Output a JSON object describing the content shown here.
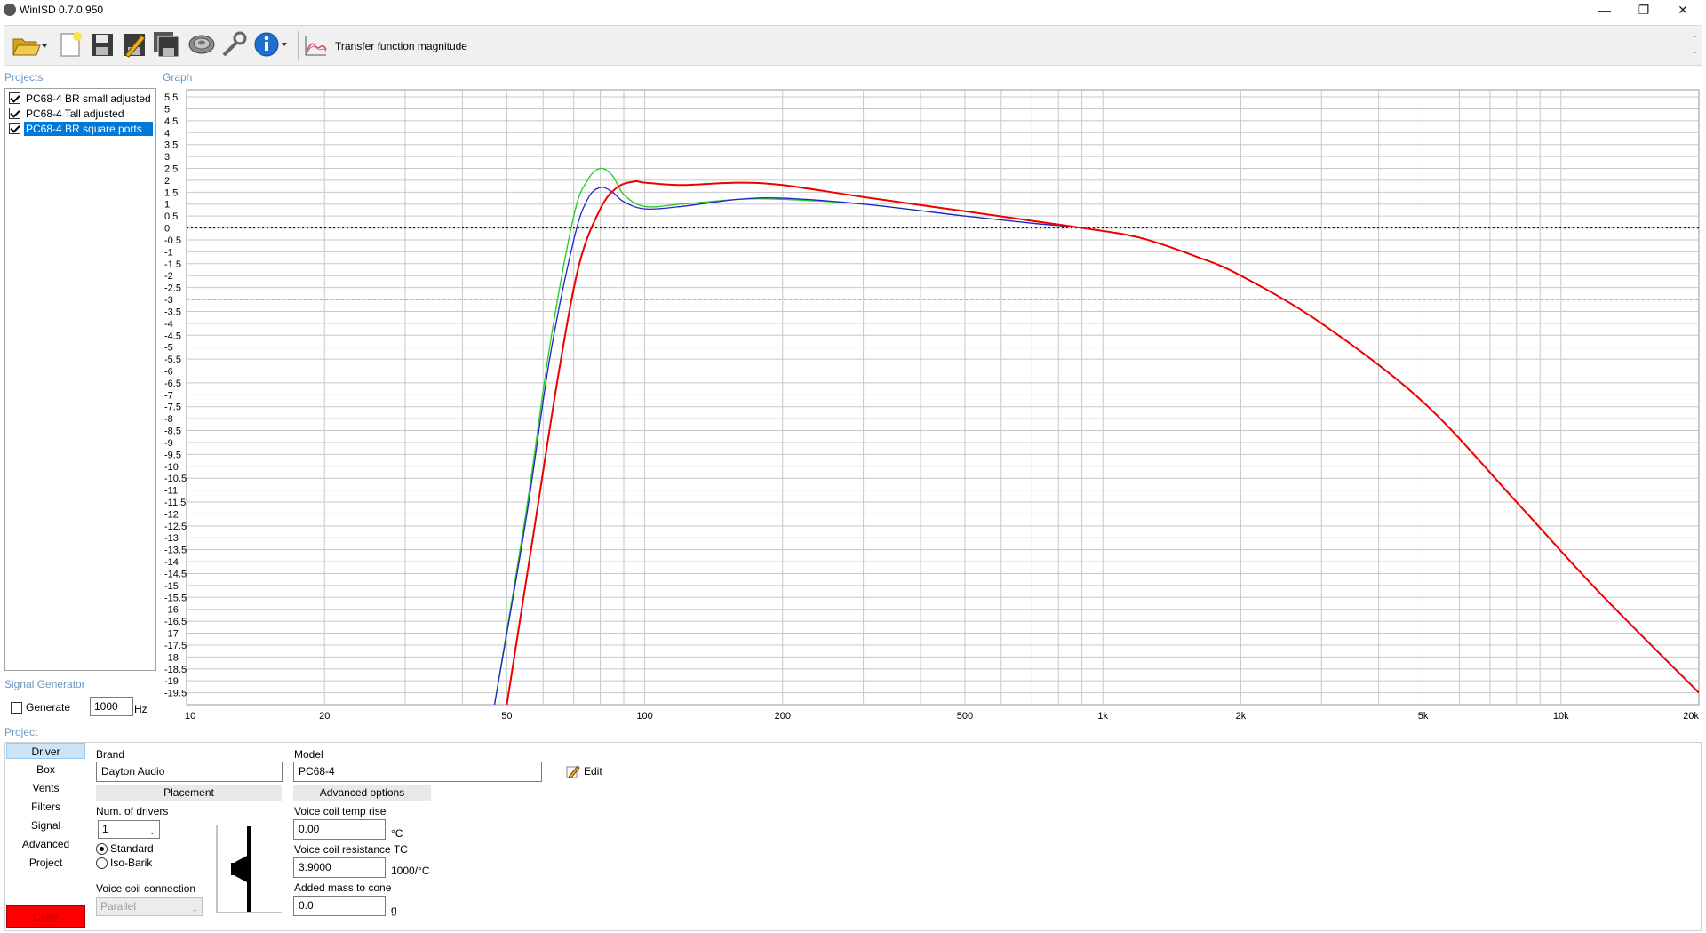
{
  "window": {
    "title": "WinISD 0.7.0.950",
    "minimize_icon": "minimize-icon",
    "restore_icon": "restore-icon",
    "close_icon": "close-icon"
  },
  "toolbar": {
    "icons": [
      "open-folder-icon",
      "new-project-icon",
      "save-icon",
      "save-as-icon",
      "save-all-icon",
      "driver-editor-icon",
      "tools-icon",
      "info-icon"
    ],
    "graph_selector_icon": "graph-icon",
    "graph_selector_label": "Transfer function magnitude",
    "side_marks": [
      "-",
      "-"
    ]
  },
  "sections": {
    "projects": "Projects",
    "graph": "Graph",
    "signal_generator": "Signal Generator",
    "project": "Project"
  },
  "projects": [
    {
      "label": "PC68-4 BR small adjusted",
      "checked": true,
      "selected": false
    },
    {
      "label": "PC68-4 Tall adjusted",
      "checked": true,
      "selected": false
    },
    {
      "label": "PC68-4 BR square ports",
      "checked": true,
      "selected": true
    }
  ],
  "signal_generator": {
    "generate_label": "Generate",
    "generate_checked": false,
    "frequency": "1000",
    "unit": "Hz"
  },
  "chart_data": {
    "type": "line",
    "title": "",
    "x_scale": "log",
    "xlim": [
      10,
      20000
    ],
    "ylim": [
      -20,
      5.8
    ],
    "x_tick_labels": [
      "10",
      "20",
      "50",
      "100",
      "200",
      "500",
      "1k",
      "2k",
      "5k",
      "10k",
      "20k"
    ],
    "x_tick_values": [
      10,
      20,
      50,
      100,
      200,
      500,
      1000,
      2000,
      5000,
      10000,
      20000
    ],
    "y_tick_labels": [
      "5.5",
      "5",
      "4.5",
      "4",
      "3.5",
      "3",
      "2.5",
      "2",
      "1.5",
      "1",
      "0.5",
      "0",
      "-0.5",
      "-1",
      "-1.5",
      "-2",
      "-2.5",
      "-3",
      "-3.5",
      "-4",
      "-4.5",
      "-5",
      "-5.5",
      "-6",
      "-6.5",
      "-7",
      "-7.5",
      "-8",
      "-8.5",
      "-9",
      "-9.5",
      "-10",
      "-10.5",
      "-11",
      "-11.5",
      "-12",
      "-12.5",
      "-13",
      "-13.5",
      "-14",
      "-14.5",
      "-15",
      "-15.5",
      "-16",
      "-16.5",
      "-17",
      "-17.5",
      "-18",
      "-18.5",
      "-19",
      "-19.5"
    ],
    "reference_lines": [
      {
        "y": 0,
        "style": "dotted"
      },
      {
        "y": -3,
        "style": "dashed"
      }
    ],
    "grid": true,
    "series": [
      {
        "color": "#22cc22",
        "x": [
          47,
          55,
          62,
          70,
          75,
          80,
          85,
          90,
          100,
          120,
          160,
          200,
          300,
          500,
          700,
          900,
          1200,
          1600,
          2000,
          3000,
          5000,
          8000,
          12000,
          20000
        ],
        "y": [
          -20,
          -12,
          -5,
          0.5,
          2.0,
          2.5,
          2.2,
          1.4,
          0.9,
          1.0,
          1.2,
          1.2,
          1.0,
          0.5,
          0.2,
          0,
          -0.4,
          -1.2,
          -2.0,
          -4.0,
          -7.3,
          -11.5,
          -15.2,
          -19.5
        ]
      },
      {
        "color": "#2222cc",
        "x": [
          47,
          55,
          62,
          70,
          75,
          80,
          85,
          90,
          100,
          120,
          160,
          200,
          300,
          500,
          700,
          900,
          1200,
          1600,
          2000,
          3000,
          5000,
          8000,
          12000,
          20000
        ],
        "y": [
          -20,
          -12.3,
          -5.5,
          -0.5,
          1.2,
          1.7,
          1.5,
          1.1,
          0.8,
          0.9,
          1.2,
          1.25,
          1.0,
          0.5,
          0.2,
          0,
          -0.4,
          -1.2,
          -2.0,
          -4.0,
          -7.3,
          -11.5,
          -15.2,
          -19.5
        ]
      },
      {
        "color": "#ee0000",
        "x": [
          50,
          57,
          65,
          72,
          80,
          87,
          95,
          100,
          120,
          160,
          200,
          300,
          500,
          700,
          900,
          1200,
          1600,
          2000,
          3000,
          5000,
          8000,
          12000,
          20000
        ],
        "y": [
          -20,
          -13,
          -6,
          -1.5,
          0.8,
          1.7,
          1.95,
          1.9,
          1.8,
          1.9,
          1.8,
          1.3,
          0.7,
          0.3,
          0,
          -0.4,
          -1.2,
          -2.0,
          -4.0,
          -7.3,
          -11.5,
          -15.2,
          -19.5
        ]
      }
    ]
  },
  "project": {
    "nav": [
      "Driver",
      "Box",
      "Vents",
      "Filters",
      "Signal",
      "Advanced",
      "Project"
    ],
    "nav_selected": 0,
    "color_button": "Color",
    "brand_label": "Brand",
    "brand_value": "Dayton Audio",
    "model_label": "Model",
    "model_value": "PC68-4",
    "edit_label": "Edit",
    "edit_icon": "pencil-icon",
    "placement_header": "Placement",
    "num_drivers_label": "Num. of drivers",
    "num_drivers_value": "1",
    "standard_label": "Standard",
    "isobarik_label": "Iso-Barik",
    "vc_connection_label": "Voice coil connection",
    "vc_connection_value": "Parallel",
    "advanced_header": "Advanced options",
    "vc_temp_label": "Voice coil temp rise",
    "vc_temp_value": "0.00",
    "vc_temp_unit": "°C",
    "vc_res_label": "Voice coil resistance TC",
    "vc_res_value": "3.9000",
    "vc_res_unit": "1000/°C",
    "added_mass_label": "Added mass to cone",
    "added_mass_value": "0.0",
    "added_mass_unit": "g"
  }
}
